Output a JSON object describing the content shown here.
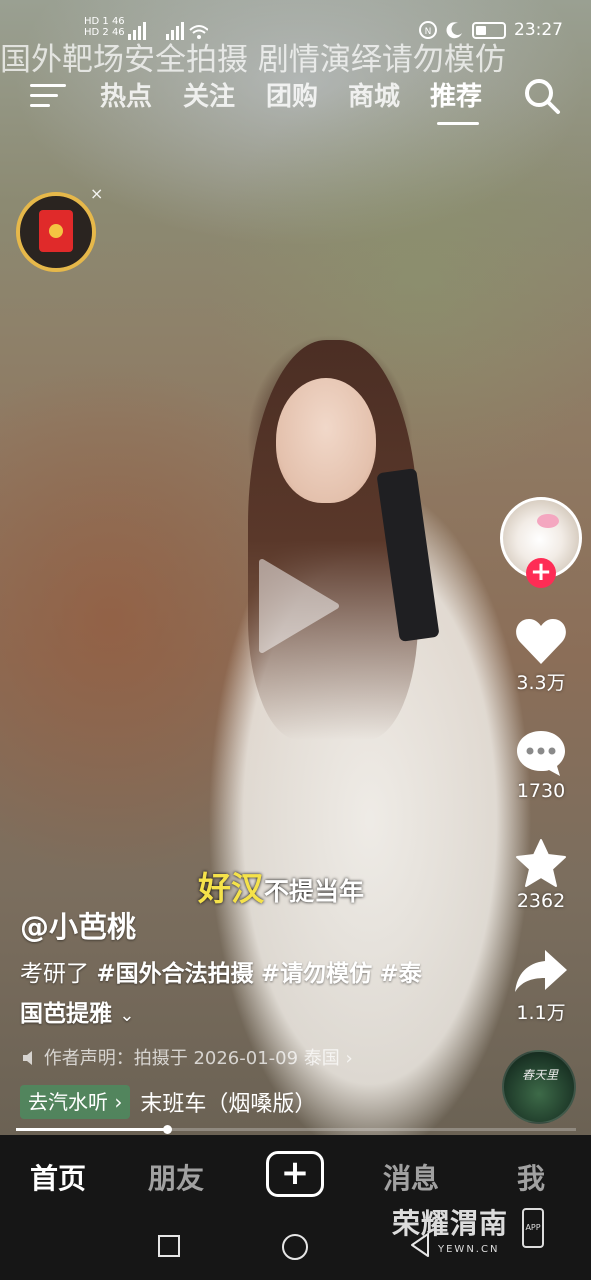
{
  "status_bar": {
    "sim1": "HD 1 46",
    "sim2": "HD 2 46",
    "time": "23:27",
    "icons": [
      "signal-icon",
      "wifi-icon",
      "nfc-icon",
      "moon-icon",
      "battery-icon"
    ]
  },
  "overlay_title": "国外靶场安全拍摄 剧情演绎请勿模仿",
  "top_nav": {
    "tabs": [
      {
        "label": "热点",
        "active": false
      },
      {
        "label": "关注",
        "active": false
      },
      {
        "label": "团购",
        "active": false
      },
      {
        "label": "商城",
        "active": false
      },
      {
        "label": "推荐",
        "active": true
      }
    ]
  },
  "red_packet": {
    "close_label": "×"
  },
  "right_rail": {
    "follow_symbol": "+",
    "like_count": "3.3万",
    "comment_count": "1730",
    "favorite_count": "2362",
    "share_count": "1.1万",
    "music_disc_text": "春天里"
  },
  "subtitle": {
    "highlight": "好汉",
    "rest": "不提当年"
  },
  "post": {
    "username": "@小芭桃",
    "desc_prefix": "考研了 ",
    "tags": [
      "#国外合法拍摄",
      "#请勿模仿",
      "#泰国芭提雅"
    ],
    "expand_symbol": "⌄",
    "declaration": "作者声明：拍摄于 2026-01-09 泰国 ›"
  },
  "music": {
    "chip_label": "去汽水听 ›",
    "name": "末班车（烟嗓版）"
  },
  "progress": 0.27,
  "bottom_tabs": {
    "home": "首页",
    "friends": "朋友",
    "create": "+",
    "messages": "消息",
    "me": "我"
  },
  "watermark": {
    "brand": "荣耀渭南",
    "url": "YEWN.CN",
    "app": "APP"
  }
}
